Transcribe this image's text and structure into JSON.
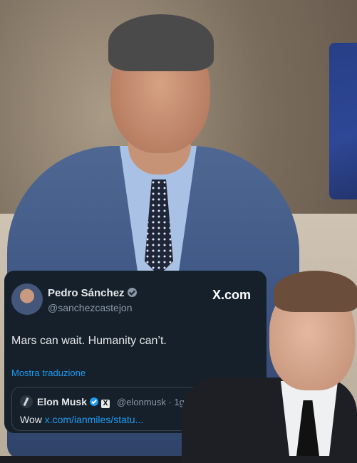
{
  "tweet": {
    "author_name": "Pedro Sánchez",
    "author_handle": "@sanchezcastejon",
    "source_label": "X.com",
    "text": "Mars can wait. Humanity can’t.",
    "translate_label": "Mostra traduzione",
    "quoted": {
      "author_name": "Elon Musk",
      "x_badge": "X",
      "meta": "@elonmusk · 1g",
      "text_prefix": "Wow ",
      "link_text": "x.com/ianmiles/statu..."
    }
  },
  "colors": {
    "card_bg": "#15202b",
    "link": "#1d9bf0",
    "verified_gray": "#8b98a5",
    "verified_blue": "#1d9bf0"
  }
}
